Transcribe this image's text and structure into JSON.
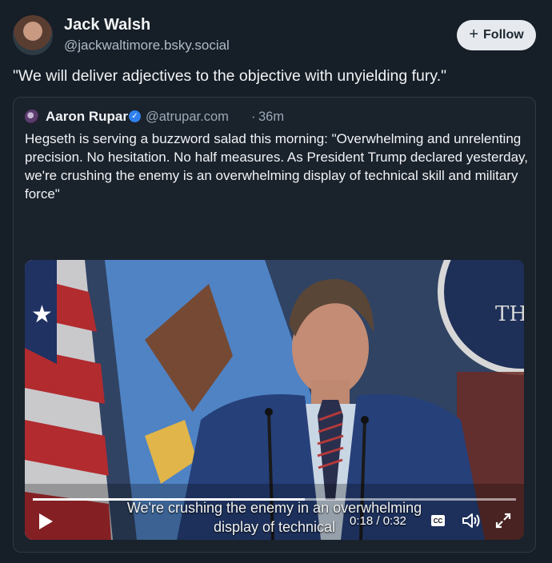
{
  "post": {
    "author_name": "Jack Walsh",
    "author_handle": "@jackwaltimore.bsky.social",
    "follow_label": "Follow",
    "follow_icon": "plus-icon",
    "text": "\"We will deliver adjectives to the objective with unyielding fury.\""
  },
  "quote": {
    "author_name": "Aaron Rupar",
    "verified_icon": "verified-check-icon",
    "author_handle": "@atrupar.com",
    "separator": "·",
    "time": "36m",
    "text": "Hegseth is serving a buzzword salad this morning: \"Overwhelming and unrelenting precision. No hesitation. No half measures. As President Trump declared yesterday, we're crushing the enemy is an overwhelming display of technical skill and military force\""
  },
  "video": {
    "caption_line1": "We're crushing the enemy in an overwhelming",
    "caption_line2": "display of technical",
    "time_display": "0:18 / 0:32",
    "progress_fraction": 0.5625,
    "cc_label": "CC",
    "seal_text": "TH",
    "icons": [
      "play-icon",
      "closed-captions-icon",
      "volume-icon",
      "fullscreen-icon"
    ]
  },
  "colors": {
    "background": "#161e27",
    "card_background": "#1a222c",
    "follow_button": "#e6eaee",
    "verified": "#2f80ed",
    "muted_text": "#9aa8b6"
  }
}
